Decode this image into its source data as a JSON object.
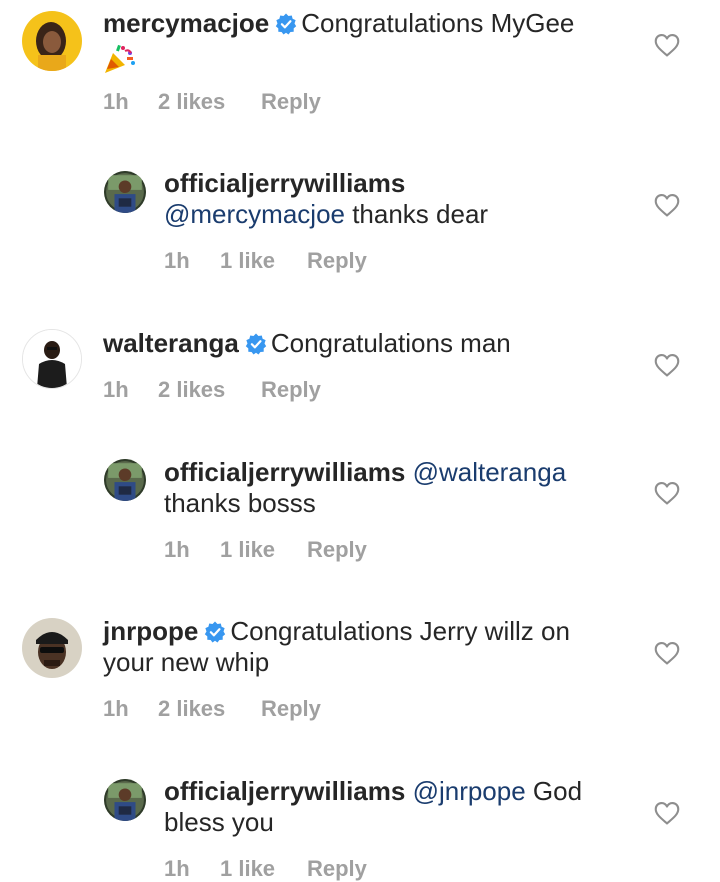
{
  "verified_badge_color": "#3897f0",
  "mention_color": "#1a3c6e",
  "meta_color": "#a0a0a0",
  "comments": [
    {
      "username": "mercymacjoe",
      "verified": true,
      "text": "Congratulations MyGee",
      "emoji": "party-popper",
      "time": "1h",
      "likes": "2 likes",
      "reply": "Reply"
    },
    {
      "username": "officialjerrywilliams",
      "verified": false,
      "mention": "@mercymacjoe",
      "text": " thanks dear",
      "time": "1h",
      "likes": "1 like",
      "reply": "Reply"
    },
    {
      "username": "walteranga",
      "verified": true,
      "text": "Congratulations man",
      "time": "1h",
      "likes": "2 likes",
      "reply": "Reply"
    },
    {
      "username": "officialjerrywilliams",
      "verified": false,
      "mention": "@walteranga",
      "text": "thanks bosss",
      "time": "1h",
      "likes": "1 like",
      "reply": "Reply"
    },
    {
      "username": "jnrpope",
      "verified": true,
      "text": "Congratulations Jerry willz on",
      "text_line2": "your new whip",
      "time": "1h",
      "likes": "2 likes",
      "reply": "Reply"
    },
    {
      "username": "officialjerrywilliams",
      "verified": false,
      "mention": "@jnrpope",
      "text": " God",
      "text_line2": "bless you",
      "time": "1h",
      "likes": "1 like",
      "reply": "Reply"
    }
  ]
}
